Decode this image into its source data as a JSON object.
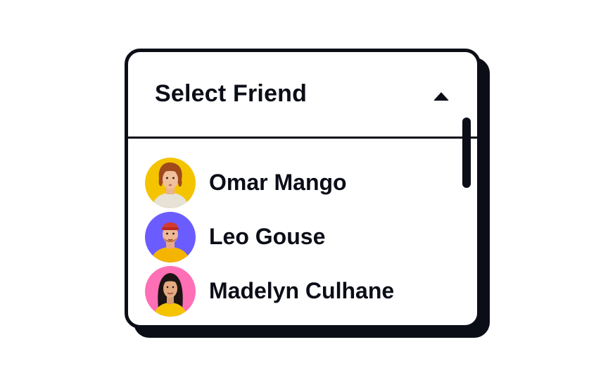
{
  "dropdown": {
    "title": "Select Friend",
    "state": "open",
    "toggle_icon": "caret-up-icon"
  },
  "friends": [
    {
      "name": "Omar Mango",
      "avatar_bg": "#f5c400",
      "avatar_icon": "avatar-omar-mango"
    },
    {
      "name": "Leo Gouse",
      "avatar_bg": "#6b5cff",
      "avatar_icon": "avatar-leo-gouse"
    },
    {
      "name": "Madelyn Culhane",
      "avatar_bg": "#ff6fb5",
      "avatar_icon": "avatar-madelyn-culhane"
    }
  ],
  "colors": {
    "ink": "#0b0d17",
    "background": "#ffffff"
  }
}
